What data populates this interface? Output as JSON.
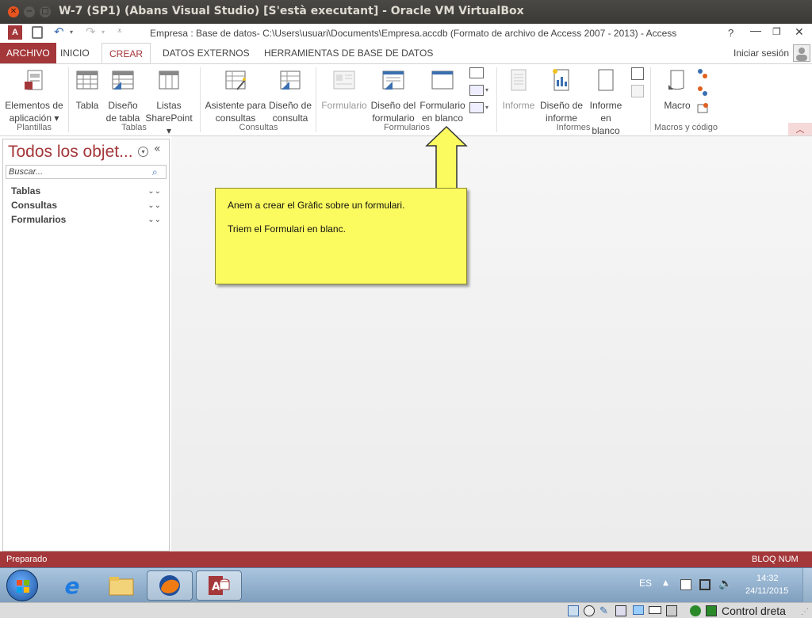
{
  "vbox": {
    "title": "W-7 (SP1) (Abans Visual Studio) [S'està executant] - Oracle VM VirtualBox"
  },
  "access": {
    "doc_title": "Empresa : Base de datos- C:\\Users\\usuari\\Documents\\Empresa.accdb (Formato de archivo de Access 2007 - 2013) - Access",
    "help": "?",
    "signin": "Iniciar sesión",
    "tabs": [
      "ARCHIVO",
      "INICIO",
      "CREAR",
      "DATOS EXTERNOS",
      "HERRAMIENTAS DE BASE DE DATOS"
    ],
    "ribbon": {
      "elementos": "Elementos de aplicación ▾",
      "tabla": "Tabla",
      "diseno_tabla": "Diseño de tabla",
      "listas": "Listas SharePoint ▾",
      "asistente": "Asistente para consultas",
      "diseno_consulta": "Diseño de consulta",
      "formulario": "Formulario",
      "diseno_formulario": "Diseño del formulario",
      "formulario_blanco": "Formulario en blanco",
      "informe": "Informe",
      "diseno_informe": "Diseño de informe",
      "informe_blanco": "Informe en blanco",
      "macro": "Macro",
      "groups": [
        "Plantillas",
        "Tablas",
        "Consultas",
        "Formularios",
        "Informes",
        "Macros y código"
      ]
    },
    "nav": {
      "header": "Todos los objet...",
      "search_placeholder": "Buscar...",
      "sections": [
        "Tablas",
        "Consultas",
        "Formularios"
      ]
    },
    "callout": {
      "line1": "Anem a crear el Gràfic sobre un formulari.",
      "line2": "Triem el Formulari en blanc."
    },
    "status": {
      "left": "Preparado",
      "right": "BLOQ NUM"
    }
  },
  "taskbar": {
    "lang": "ES",
    "time": "14:32",
    "date": "24/11/2015"
  },
  "vbox_status": {
    "host_key": "Control dreta"
  },
  "colors": {
    "access_red": "#a4373a",
    "callout_yellow": "#fbfb60"
  }
}
